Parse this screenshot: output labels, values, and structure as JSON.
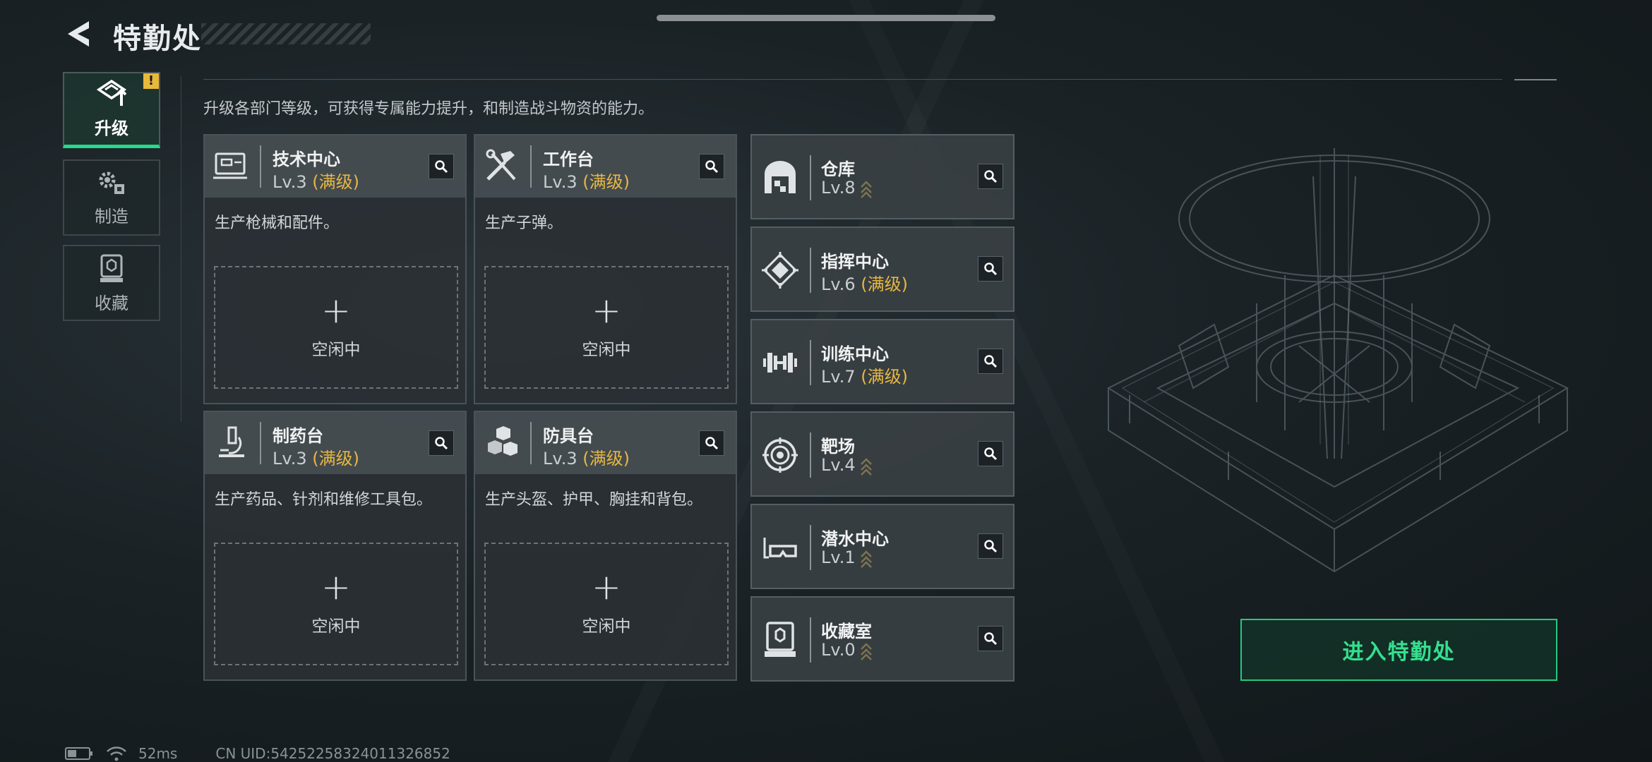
{
  "header": {
    "title": "特勤处",
    "back_icon": "back-arrow-icon"
  },
  "tabs": [
    {
      "label": "升级",
      "icon": "upgrade-icon",
      "active": true,
      "alert": "!"
    },
    {
      "label": "制造",
      "icon": "gears-icon",
      "active": false
    },
    {
      "label": "收藏",
      "icon": "collection-icon",
      "active": false
    }
  ],
  "description": "升级各部门等级，可获得专属能力提升，和制造战斗物资的能力。",
  "big_cards": [
    {
      "name": "技术中心",
      "level": "Lv.3",
      "max": "(满级)",
      "desc": "生产枪械和配件。",
      "slot_plus": "+",
      "slot_status": "空闲中",
      "icon": "computer-icon"
    },
    {
      "name": "工作台",
      "level": "Lv.3",
      "max": "(满级)",
      "desc": "生产子弹。",
      "slot_plus": "+",
      "slot_status": "空闲中",
      "icon": "tools-icon"
    },
    {
      "name": "制药台",
      "level": "Lv.3",
      "max": "(满级)",
      "desc": "生产药品、针剂和维修工具包。",
      "slot_plus": "+",
      "slot_status": "空闲中",
      "icon": "microscope-icon"
    },
    {
      "name": "防具台",
      "level": "Lv.3",
      "max": "(满级)",
      "desc": "生产头盔、护甲、胸挂和背包。",
      "slot_plus": "+",
      "slot_status": "空闲中",
      "icon": "armor-blocks-icon"
    }
  ],
  "small_cards": [
    {
      "name": "仓库",
      "level": "Lv.8",
      "max": "",
      "upgradable": true,
      "icon": "warehouse-icon"
    },
    {
      "name": "指挥中心",
      "level": "Lv.6",
      "max": "(满级)",
      "upgradable": false,
      "icon": "command-chip-icon"
    },
    {
      "name": "训练中心",
      "level": "Lv.7",
      "max": "(满级)",
      "upgradable": false,
      "icon": "dumbbell-icon"
    },
    {
      "name": "靶场",
      "level": "Lv.4",
      "max": "",
      "upgradable": true,
      "icon": "target-icon"
    },
    {
      "name": "潜水中心",
      "level": "Lv.1",
      "max": "",
      "upgradable": true,
      "icon": "diving-mask-icon"
    },
    {
      "name": "收藏室",
      "level": "Lv.0",
      "max": "",
      "upgradable": true,
      "icon": "display-case-icon"
    }
  ],
  "enter_button": "进入特勤处",
  "footer": {
    "ping": "52ms",
    "uid": "CN UID:54252258324011326852"
  },
  "colors": {
    "accent_green": "#27d98a",
    "max_level_gold": "#e5b744",
    "alert_yellow": "#e8b93a"
  }
}
